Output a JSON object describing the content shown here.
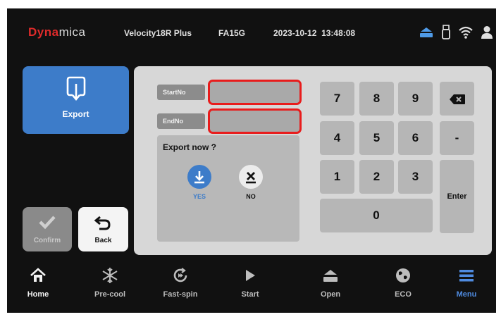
{
  "header": {
    "brand_part1": "Dyna",
    "brand_part2": "mica",
    "model": "Velocity18R Plus",
    "rotor": "FA15G",
    "date": "2023-10-12",
    "time": "13:48:08",
    "icons": [
      "lid-icon",
      "usb-drive-icon",
      "wifi-icon",
      "user-icon"
    ]
  },
  "sidebar": {
    "export_label": "Export",
    "confirm_label": "Confirm",
    "back_label": "Back"
  },
  "form": {
    "start_label": "StartNo",
    "start_value": "",
    "end_label": "EndNo",
    "end_value": "",
    "prompt": "Export now ?",
    "yes_label": "YES",
    "no_label": "NO"
  },
  "keypad": {
    "k7": "7",
    "k8": "8",
    "k9": "9",
    "k4": "4",
    "k5": "5",
    "k6": "6",
    "k1": "1",
    "k2": "2",
    "k3": "3",
    "k0": "0",
    "minus": "-",
    "enter": "Enter"
  },
  "nav": {
    "home": "Home",
    "precool": "Pre-cool",
    "fastspin": "Fast-spin",
    "start": "Start",
    "open": "Open",
    "eco": "ECO",
    "menu": "Menu",
    "active": "Menu"
  },
  "colors": {
    "accent": "#3d7cc9",
    "highlight": "#e81c1c",
    "active_nav": "#4f8be0",
    "brand_red": "#e02b2b"
  }
}
